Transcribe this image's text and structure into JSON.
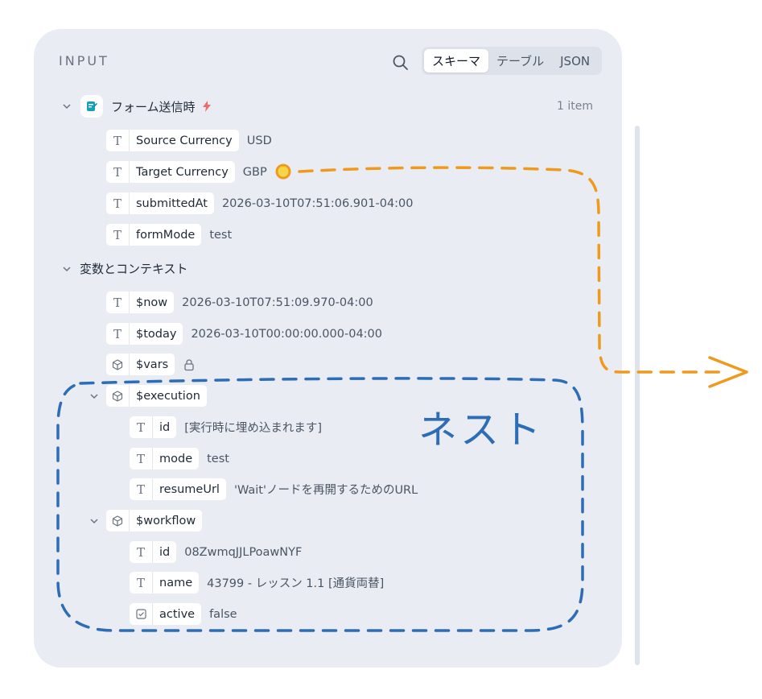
{
  "panel": {
    "title": "INPUT",
    "tabs": [
      {
        "label": "スキーマ",
        "active": true
      },
      {
        "label": "テーブル",
        "active": false
      },
      {
        "label": "JSON",
        "active": false
      }
    ]
  },
  "trigger": {
    "label": "フォーム送信時",
    "count": "1 item",
    "fields": [
      {
        "type": "T",
        "key": "Source Currency",
        "value": "USD"
      },
      {
        "type": "T",
        "key": "Target Currency",
        "value": "GBP"
      },
      {
        "type": "T",
        "key": "submittedAt",
        "value": "2026-03-10T07:51:06.901-04:00"
      },
      {
        "type": "T",
        "key": "formMode",
        "value": "test"
      }
    ]
  },
  "context": {
    "label": "変数とコンテキスト",
    "fields": [
      {
        "type": "T",
        "key": "$now",
        "value": "2026-03-10T07:51:09.970-04:00"
      },
      {
        "type": "T",
        "key": "$today",
        "value": "2026-03-10T00:00:00.000-04:00"
      },
      {
        "type": "obj",
        "key": "$vars"
      }
    ],
    "execution": {
      "key": "$execution",
      "fields": [
        {
          "type": "T",
          "key": "id",
          "value": "[実行時に埋め込まれます]"
        },
        {
          "type": "T",
          "key": "mode",
          "value": "test"
        },
        {
          "type": "T",
          "key": "resumeUrl",
          "value": "'Wait'ノードを再開するためのURL"
        }
      ]
    },
    "workflow": {
      "key": "$workflow",
      "fields": [
        {
          "type": "T",
          "key": "id",
          "value": "08ZwmqJJLPoawNYF"
        },
        {
          "type": "T",
          "key": "name",
          "value": "43799 - レッスン 1.1 [通貨両替]"
        },
        {
          "type": "bool",
          "key": "active",
          "value": "false"
        }
      ]
    }
  },
  "annotation": {
    "label": "ネスト",
    "colors": {
      "orange": "#ef9a1e",
      "blue": "#2c6db5"
    }
  }
}
